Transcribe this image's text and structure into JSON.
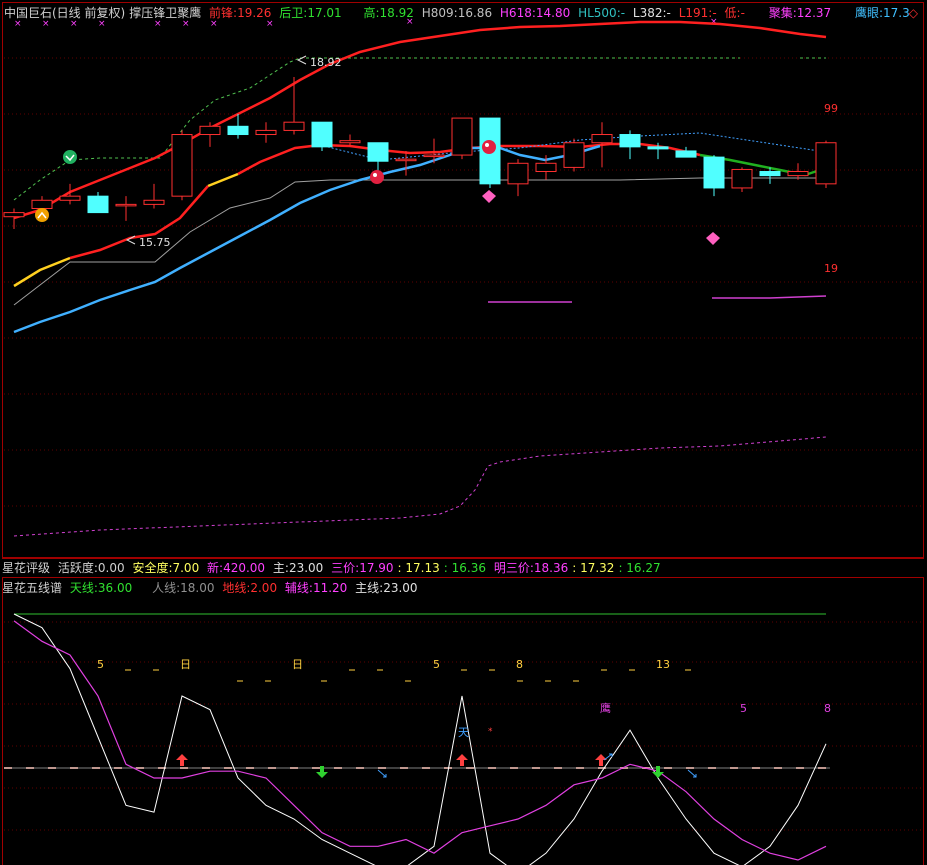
{
  "header": {
    "stock_name": "中国巨石(日线 前复权)",
    "indicator_name": "撑压锋卫聚鹰",
    "qianfeng_label": "前锋:",
    "qianfeng_value": "19.26",
    "houwei_label": "后卫:",
    "houwei_value": "17.01",
    "gao_label": "高:",
    "gao_value": "18.92",
    "h809_label": "H809:",
    "h809_value": "16.86",
    "h618_label": "H618:",
    "h618_value": "14.80",
    "hl500_label": "HL500:",
    "hl500_value": "-",
    "l382_label": "L382:",
    "l382_value": "-",
    "l191_label": "L191:",
    "l191_value": "-",
    "di_label": "低:",
    "di_value": "-",
    "jujie_label": "聚集:",
    "jujie_value": "12.37",
    "yingyan_label": "鹰眼:",
    "yingyan_value": "17.3",
    "icons": "◇"
  },
  "rating": {
    "title": "星花评级",
    "huoyue_label": "活跃度:",
    "huoyue_value": "0.00",
    "anquan_label": "安全度:",
    "anquan_value": "7.00",
    "xin_label": "新:",
    "xin_value": "420.00",
    "zhu_label": "主:",
    "zhu_value": "23.00",
    "sanjia_label": "三价:",
    "sanjia_v1": "17.90",
    "sanjia_v2": ": 17.13",
    "sanjia_v3": ": 16.36",
    "mingsanjia_label": "明三价:",
    "mingsanjia_v1": "18.36",
    "mingsanjia_v2": ": 17.32",
    "mingsanjia_v3": ": 16.27"
  },
  "lines": {
    "title": "星花五线谱",
    "tian_label": "天线:",
    "tian_value": "36.00",
    "ren_label": "人线:",
    "ren_value": "18.00",
    "di_label": "地线:",
    "di_value": "2.00",
    "fu_label": "辅线:",
    "fu_value": "11.20",
    "zhu_label": "主线:",
    "zhu_value": "23.00"
  },
  "chart_data": [
    {
      "type": "candlestick",
      "ylim": [
        12.5,
        19.8
      ],
      "annotations": {
        "high_label": "18.92",
        "low_label": "15.75",
        "right_top": "99",
        "right_bottom": "19"
      },
      "candles": [
        {
          "o": 15.5,
          "h": 15.7,
          "l": 15.2,
          "c": 15.6
        },
        {
          "o": 15.7,
          "h": 16.0,
          "l": 15.5,
          "c": 15.9
        },
        {
          "o": 15.9,
          "h": 16.3,
          "l": 15.8,
          "c": 16.0
        },
        {
          "o": 16.0,
          "h": 16.1,
          "l": 15.6,
          "c": 15.6
        },
        {
          "o": 15.8,
          "h": 16.0,
          "l": 15.4,
          "c": 15.8
        },
        {
          "o": 15.8,
          "h": 16.3,
          "l": 15.7,
          "c": 15.9
        },
        {
          "o": 16.0,
          "h": 17.6,
          "l": 15.9,
          "c": 17.5
        },
        {
          "o": 17.5,
          "h": 17.8,
          "l": 17.2,
          "c": 17.7
        },
        {
          "o": 17.7,
          "h": 18.0,
          "l": 17.4,
          "c": 17.5
        },
        {
          "o": 17.5,
          "h": 17.8,
          "l": 17.3,
          "c": 17.6
        },
        {
          "o": 17.6,
          "h": 18.9,
          "l": 17.5,
          "c": 17.8
        },
        {
          "o": 17.8,
          "h": 17.8,
          "l": 17.1,
          "c": 17.2
        },
        {
          "o": 17.3,
          "h": 17.5,
          "l": 17.2,
          "c": 17.35
        },
        {
          "o": 17.3,
          "h": 17.3,
          "l": 16.6,
          "c": 16.85
        },
        {
          "o": 16.9,
          "h": 17.1,
          "l": 16.5,
          "c": 16.9
        },
        {
          "o": 17.0,
          "h": 17.4,
          "l": 16.8,
          "c": 17.0
        },
        {
          "o": 17.0,
          "h": 17.9,
          "l": 16.9,
          "c": 17.9
        },
        {
          "o": 17.9,
          "h": 17.9,
          "l": 16.2,
          "c": 16.3
        },
        {
          "o": 16.3,
          "h": 16.9,
          "l": 16.0,
          "c": 16.8
        },
        {
          "o": 16.6,
          "h": 17.0,
          "l": 16.4,
          "c": 16.8
        },
        {
          "o": 16.7,
          "h": 17.4,
          "l": 16.6,
          "c": 17.3
        },
        {
          "o": 17.3,
          "h": 17.8,
          "l": 16.7,
          "c": 17.5
        },
        {
          "o": 17.5,
          "h": 17.6,
          "l": 16.9,
          "c": 17.2
        },
        {
          "o": 17.2,
          "h": 17.3,
          "l": 16.9,
          "c": 17.15
        },
        {
          "o": 17.1,
          "h": 17.2,
          "l": 17.0,
          "c": 16.95
        },
        {
          "o": 16.95,
          "h": 17.0,
          "l": 16.0,
          "c": 16.2
        },
        {
          "o": 16.2,
          "h": 16.7,
          "l": 16.1,
          "c": 16.65
        },
        {
          "o": 16.6,
          "h": 16.7,
          "l": 16.3,
          "c": 16.5
        },
        {
          "o": 16.5,
          "h": 16.8,
          "l": 16.4,
          "c": 16.6
        },
        {
          "o": 16.3,
          "h": 17.35,
          "l": 16.2,
          "c": 17.3
        }
      ]
    },
    {
      "type": "line",
      "ylim": [
        0,
        36
      ],
      "series": [
        {
          "values": [
            36,
            34,
            28,
            18,
            8,
            7,
            24,
            22,
            12,
            8,
            6,
            3,
            1,
            -1,
            -1,
            2,
            24,
            1,
            -2,
            1,
            6,
            13,
            19,
            12,
            6,
            1,
            -1,
            2,
            8,
            17
          ]
        },
        {
          "values": [
            35,
            32,
            30,
            24,
            14,
            12,
            12,
            13,
            13,
            12,
            8,
            4,
            2,
            2,
            3,
            1,
            4,
            5,
            6,
            8,
            11,
            12,
            14,
            13,
            10,
            6,
            3,
            1,
            0,
            2
          ]
        }
      ],
      "texts": [
        "5",
        "日",
        "日",
        "5",
        "8",
        "13",
        "5",
        "8",
        "天",
        "鹰"
      ]
    }
  ]
}
